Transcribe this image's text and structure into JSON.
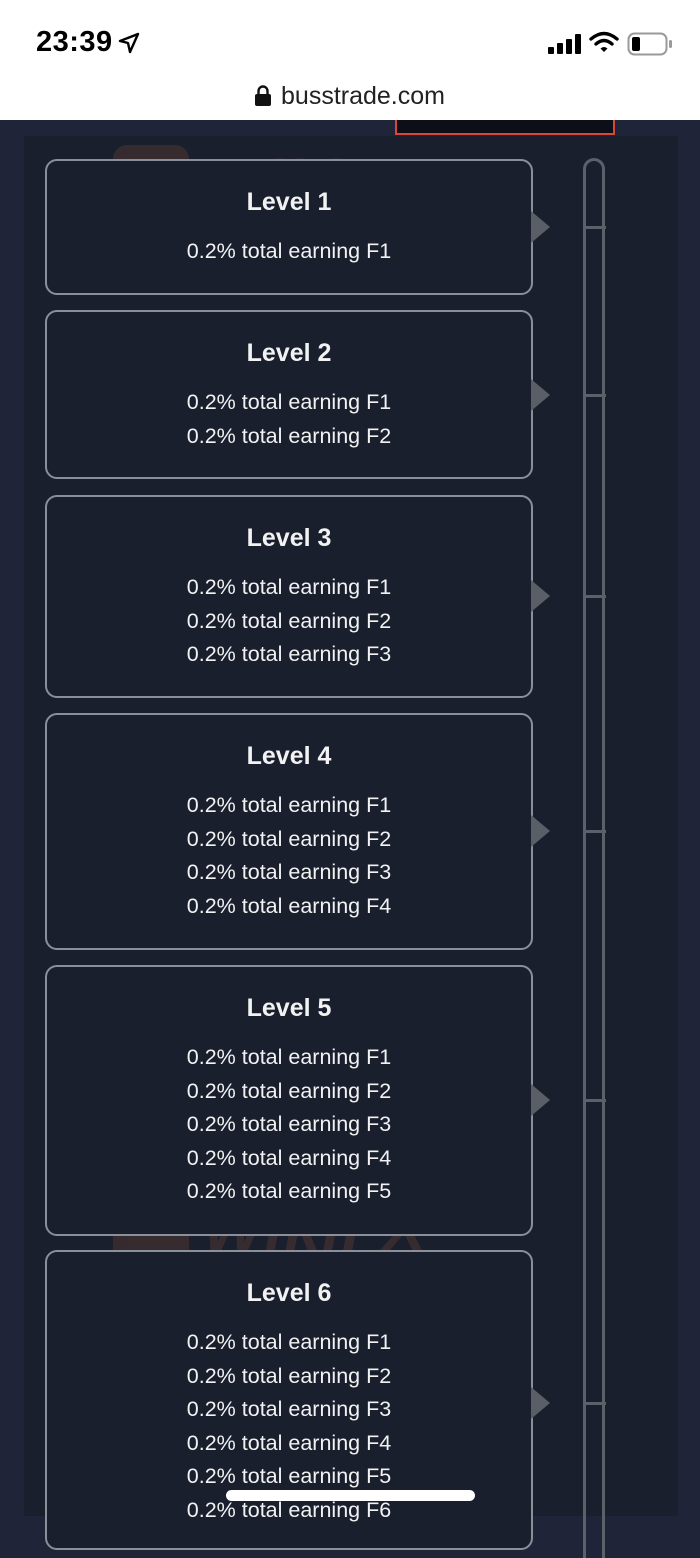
{
  "status_bar": {
    "time": "23:39",
    "icons": [
      "location-arrow-icon",
      "signal-icon",
      "wifi-icon",
      "battery-icon"
    ]
  },
  "browser": {
    "url": "busstrade.com"
  },
  "levels": [
    {
      "title": "Level 1",
      "lines": [
        "0.2% total earning F1"
      ]
    },
    {
      "title": "Level 2",
      "lines": [
        "0.2% total earning F1",
        "0.2% total earning F2"
      ]
    },
    {
      "title": "Level 3",
      "lines": [
        "0.2% total earning F1",
        "0.2% total earning F2",
        "0.2% total earning F3"
      ]
    },
    {
      "title": "Level 4",
      "lines": [
        "0.2% total earning F1",
        "0.2% total earning F2",
        "0.2% total earning F3",
        "0.2% total earning F4"
      ]
    },
    {
      "title": "Level 5",
      "lines": [
        "0.2% total earning F1",
        "0.2% total earning F2",
        "0.2% total earning F3",
        "0.2% total earning F4",
        "0.2% total earning F5"
      ]
    },
    {
      "title": "Level 6",
      "lines": [
        "0.2% total earning F1",
        "0.2% total earning F2",
        "0.2% total earning F3",
        "0.2% total earning F4",
        "0.2% total earning F5",
        "0.2% total earning F6"
      ]
    }
  ],
  "watermark": {
    "text": "WikiFX"
  },
  "colors": {
    "page_bg": "#1f2438",
    "card_bg": "#1a1f2e",
    "card_border": "#8b8f99",
    "accent_red": "#d9473a",
    "timeline": "#5c6068"
  }
}
